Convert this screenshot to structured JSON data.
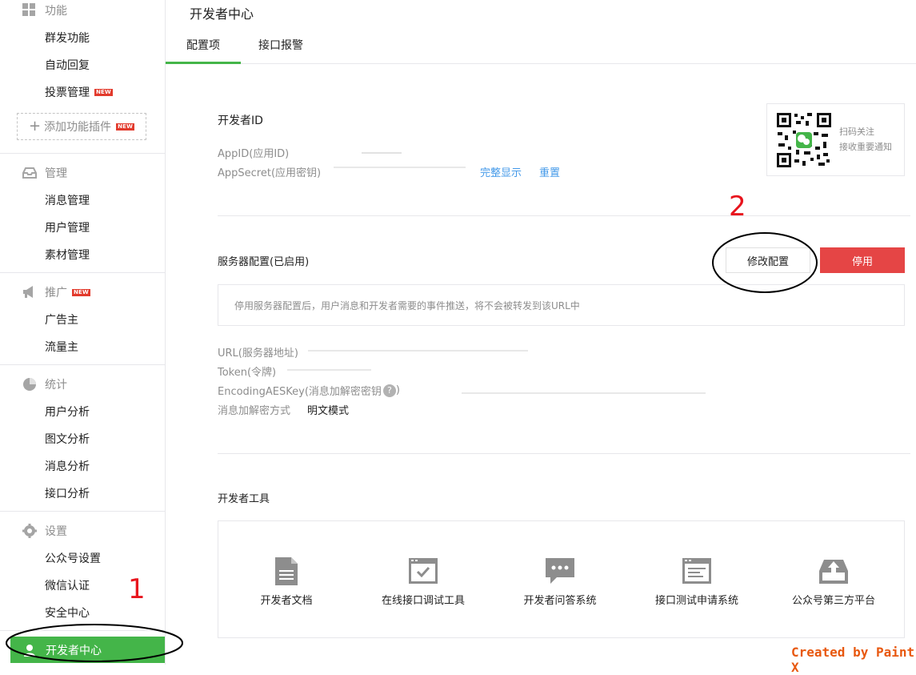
{
  "sidebar": {
    "sections": {
      "features": {
        "title": "功能",
        "items": [
          "群发功能",
          "自动回复",
          "投票管理"
        ],
        "new_badge": "NEW"
      },
      "add_plugin": "添加功能插件",
      "manage": {
        "title": "管理",
        "items": [
          "消息管理",
          "用户管理",
          "素材管理"
        ]
      },
      "promote": {
        "title": "推广",
        "new_badge": "NEW",
        "items": [
          "广告主",
          "流量主"
        ]
      },
      "stats": {
        "title": "统计",
        "items": [
          "用户分析",
          "图文分析",
          "消息分析",
          "接口分析"
        ]
      },
      "settings": {
        "title": "设置",
        "items": [
          "公众号设置",
          "微信认证",
          "安全中心"
        ]
      }
    },
    "active_item": "开发者中心"
  },
  "main": {
    "title": "开发者中心",
    "tabs": [
      "配置项",
      "接口报警"
    ],
    "developer_id": {
      "heading": "开发者ID",
      "appid_label": "AppID(应用ID)",
      "appsecret_label": "AppSecret(应用密钥)",
      "show_full": "完整显示",
      "reset": "重置"
    },
    "qr": {
      "line1": "扫码关注",
      "line2": "接收重要通知"
    },
    "server": {
      "heading": "服务器配置(已启用)",
      "modify_btn": "修改配置",
      "disable_btn": "停用",
      "notice": "停用服务器配置后，用户消息和开发者需要的事件推送，将不会被转发到该URL中",
      "url_label": "URL(服务器地址)",
      "token_label": "Token(令牌)",
      "aeskey_label": "EncodingAESKey(消息加解密密钥",
      "aeskey_help": "?",
      "aeskey_label_end": ")",
      "mode_label": "消息加解密方式",
      "mode_value": "明文模式"
    },
    "tools": {
      "heading": "开发者工具",
      "items": [
        "开发者文档",
        "在线接口调试工具",
        "开发者问答系统",
        "接口测试申请系统",
        "公众号第三方平台"
      ]
    }
  },
  "annotations": {
    "mark1": "1",
    "mark2": "2",
    "watermark": "Created by Paint X"
  },
  "colors": {
    "green": "#44b549",
    "red": "#e54545",
    "link": "#459ae9",
    "annotation_red": "#e8141d",
    "watermark": "#e8580f"
  }
}
